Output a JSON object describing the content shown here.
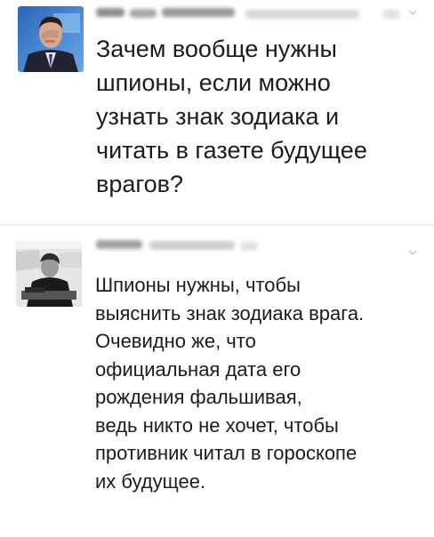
{
  "tweets": [
    {
      "avatar_icon": "user-avatar-photo-facepalm",
      "text": "Зачем вообще нужны\nшпионы, если можно\nузнать знак зодиака и\nчитать в газете будущее\nврагов?"
    },
    {
      "avatar_icon": "user-avatar-photo-grayscale",
      "text": "Шпионы нужны, чтобы\nвыяснить знак зодиака врага.\nОчевидно же, что\nофициальная дата его\nрождения фальшивая,\nведь никто не хочет, чтобы\nпротивник читал в гороскопе\nих будущее."
    }
  ],
  "menu_icon": "chevron-down-icon",
  "colors": {
    "text": "#1c1c1c",
    "divider": "#e6e6e6",
    "background": "#ffffff"
  }
}
